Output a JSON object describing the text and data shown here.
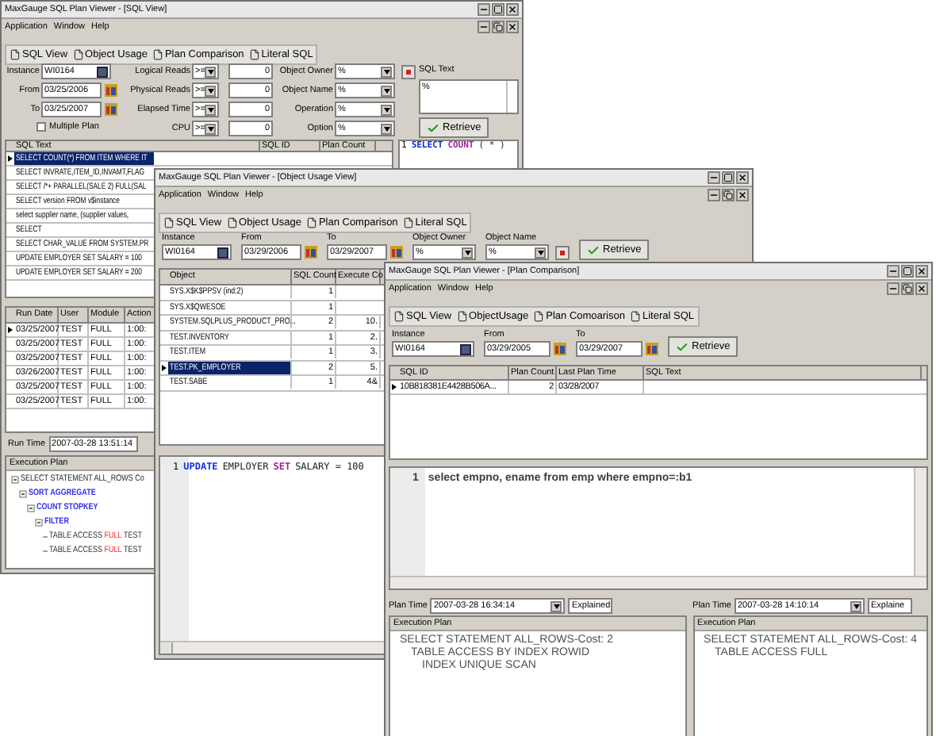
{
  "sql_view_window": {
    "title": "MaxGauge SQL Plan Viewer - [SQL View]",
    "menu": [
      "Application",
      "Window",
      "Help"
    ],
    "tabs": [
      "SQL View",
      "Object Usage",
      "Plan Comparison",
      "Literal SQL"
    ],
    "instance": {
      "label": "Instance",
      "value": "WI0164"
    },
    "from": {
      "label": "From",
      "value": "03/25/2006"
    },
    "to": {
      "label": "To",
      "value": "03/25/2007"
    },
    "multiple_plan": {
      "label": "Multiple Plan",
      "checked": false
    },
    "thresholds": [
      {
        "label": "Logical Reads",
        "operator": ">=",
        "value": "0"
      },
      {
        "label": "Physical Reads",
        "operator": ">=",
        "value": "0"
      },
      {
        "label": "Elapsed Time",
        "operator": ">=",
        "value": "0"
      },
      {
        "label": "CPU",
        "operator": ">=",
        "value": "0"
      }
    ],
    "object_filters": [
      {
        "label": "Object Owner",
        "value": "%"
      },
      {
        "label": "Object Name",
        "value": "%"
      },
      {
        "label": "Operation",
        "value": "%"
      },
      {
        "label": "Option",
        "value": "%"
      }
    ],
    "sql_text": {
      "label": "SQL Text",
      "value": "%"
    },
    "retrieve": "Retrieve",
    "sql_grid": {
      "columns": [
        "SQL Text",
        "SQL ID",
        "Plan Count"
      ],
      "rows": [
        {
          "sql_text": "SELECT COUNT(*) FROM ITEM WHERE IT",
          "selected": true
        },
        {
          "sql_text": "SELECT INVRATE,ITEM_ID,INVAMT,FLAG",
          "selected": false
        },
        {
          "sql_text": "SELECT /*+ PARALLEL(SALE 2) FULL(SAL",
          "selected": false
        },
        {
          "sql_text": "SELECT version FROM v$instance",
          "selected": false
        },
        {
          "sql_text": "select supplier name, (supplier values,",
          "selected": false
        },
        {
          "sql_text": "SELECT",
          "selected": false
        },
        {
          "sql_text": "SELECT CHAR_VALUE FROM SYSTEM.PR",
          "selected": false
        },
        {
          "sql_text": "UPDATE EMPLOYER SET SALARY = 100",
          "selected": false
        },
        {
          "sql_text": "UPDATE EMPLOYER SET SALARY = 200",
          "selected": false
        }
      ]
    },
    "editor": [
      {
        "number": "1",
        "tokens": [
          {
            "text": "SELECT",
            "kind": "keyword"
          },
          {
            "text": "COUNT",
            "kind": "function"
          },
          {
            "text": "( * )",
            "kind": "plain"
          }
        ]
      }
    ],
    "run_grid": {
      "columns": [
        "Run Date",
        "User",
        "Module",
        "Action"
      ],
      "rows": [
        {
          "cells": [
            "03/25/2007",
            "TEST",
            "FULL",
            "1:00:"
          ],
          "selected": true
        },
        {
          "cells": [
            "03/25/2007",
            "TEST",
            "FULL",
            "1:00:"
          ],
          "selected": false
        },
        {
          "cells": [
            "03/25/2007",
            "TEST",
            "FULL",
            "1:00:"
          ],
          "selected": false
        },
        {
          "cells": [
            "03/26/2007",
            "TEST",
            "FULL",
            "1:00:"
          ],
          "selected": false
        },
        {
          "cells": [
            "03/25/2007",
            "TEST",
            "FULL",
            "1:00:"
          ],
          "selected": false
        },
        {
          "cells": [
            "03/25/2007",
            "TEST",
            "FULL",
            "1:00:"
          ],
          "selected": false
        }
      ]
    },
    "run_time": {
      "label": "Run Time",
      "value": "2007-03-28 13:51:14"
    },
    "execution_plan": {
      "title": "Execution Plan",
      "nodes": [
        {
          "kind": "root",
          "segments": [
            {
              "text": "SELECT STATEMENT ALL_ROWS Co",
              "kind": "plain"
            }
          ],
          "expanded": true,
          "children": [
            {
              "kind": "operation",
              "segments": [
                {
                  "text": "SORT AGGREGATE",
                  "kind": "plain"
                }
              ],
              "expanded": true,
              "children": [
                {
                  "kind": "operation",
                  "segments": [
                    {
                      "text": "COUNT STOPKEY",
                      "kind": "plain"
                    }
                  ],
                  "expanded": true,
                  "children": [
                    {
                      "kind": "operation",
                      "segments": [
                        {
                          "text": "FILTER",
                          "kind": "plain"
                        }
                      ],
                      "expanded": true,
                      "children": [
                        {
                          "kind": "leaf",
                          "segments": [
                            {
                              "text": "TABLE ACCESS",
                              "kind": "plain"
                            },
                            {
                              "text": "FULL",
                              "kind": "option"
                            },
                            {
                              "text": "TEST",
                              "kind": "plain"
                            }
                          ]
                        },
                        {
                          "kind": "leaf",
                          "segments": [
                            {
                              "text": "TABLE ACCESS",
                              "kind": "plain"
                            },
                            {
                              "text": "FULL",
                              "kind": "option"
                            },
                            {
                              "text": "TEST",
                              "kind": "plain"
                            }
                          ]
                        }
                      ]
                    }
                  ]
                }
              ]
            }
          ]
        }
      ]
    }
  },
  "object_usage_window": {
    "title": "MaxGauge SQL Plan Viewer - [Object Usage View]",
    "menu": [
      "Application",
      "Window",
      "Help"
    ],
    "tabs": [
      "SQL View",
      "Object Usage",
      "Plan Comparison",
      "Literal SQL"
    ],
    "instance": {
      "label": "Instance",
      "value": "WI0164"
    },
    "from": {
      "label": "From",
      "value": "03/29/2006"
    },
    "to": {
      "label": "To",
      "value": "03/29/2007"
    },
    "object_owner": {
      "label": "Object Owner",
      "value": "%"
    },
    "object_name": {
      "label": "Object Name",
      "value": "%"
    },
    "retrieve": "Retrieve",
    "grid": {
      "columns": [
        "Object",
        "SQL Count",
        "Execute Co"
      ],
      "rows": [
        {
          "cells": [
            "SYS.X$K$PPSV (ind:2)",
            "1",
            ""
          ],
          "selected": false
        },
        {
          "cells": [
            "SYS.X$QWESOE",
            "1",
            ""
          ],
          "selected": false
        },
        {
          "cells": [
            "SYSTEM.SQLPLUS_PRODUCT_PRO...",
            "2",
            "10."
          ],
          "selected": false
        },
        {
          "cells": [
            "TEST.INVENTORY",
            "1",
            "2."
          ],
          "selected": false
        },
        {
          "cells": [
            "TEST.ITEM",
            "1",
            "3."
          ],
          "selected": false
        },
        {
          "cells": [
            "TEST.PK_EMPLOYER",
            "2",
            "5."
          ],
          "selected": true
        },
        {
          "cells": [
            "TEST.SABE",
            "1",
            "4&"
          ],
          "selected": false
        }
      ]
    },
    "editor": [
      {
        "number": "1",
        "tokens": [
          {
            "text": "UPDATE",
            "kind": "keyword"
          },
          {
            "text": "EMPLOYER",
            "kind": "plain"
          },
          {
            "text": "SET",
            "kind": "function"
          },
          {
            "text": "SALARY = 100",
            "kind": "plain"
          }
        ]
      }
    ]
  },
  "plan_comparison_window": {
    "title": "MaxGauge SQL Plan Viewer - [Plan Comparison]",
    "menu": [
      "Application",
      "Window",
      "Help"
    ],
    "tabs": [
      "SQL View",
      "ObjectUsage",
      "Plan Comoarison",
      "Literal SQL"
    ],
    "instance": {
      "label": "Instance",
      "value": "WI0164"
    },
    "from": {
      "label": "From",
      "value": "03/29/2005"
    },
    "to": {
      "label": "To",
      "value": "03/29/2007"
    },
    "retrieve": "Retrieve",
    "grid": {
      "columns": [
        "SQL ID",
        "Plan Count",
        "Last Plan Time",
        "SQL Text"
      ],
      "rows": [
        {
          "cells": [
            "10B818381E4428B506A...",
            "2",
            "03/28/2007",
            ""
          ],
          "selected": true
        }
      ]
    },
    "editor": [
      {
        "number": "1",
        "text": "select empno, ename from emp where empno=:b1"
      }
    ],
    "plans": [
      {
        "plan_time_label": "Plan Time",
        "plan_time": "2007-03-28 16:34:14",
        "status": "Explained",
        "title": "Execution Plan",
        "lines": [
          {
            "text": "SELECT STATEMENT ALL_ROWS-Cost: 2",
            "children": [
              {
                "text": "TABLE ACCESS BY INDEX ROWID",
                "children": [
                  {
                    "text": "INDEX UNIQUE SCAN"
                  }
                ]
              }
            ]
          }
        ]
      },
      {
        "plan_time_label": "Plan Time",
        "plan_time": "2007-03-28 14:10:14",
        "status": "Explaine",
        "title": "Execution Plan",
        "lines": [
          {
            "text": "SELECT STATEMENT ALL_ROWS-Cost: 4",
            "children": [
              {
                "text": "TABLE ACCESS FULL"
              }
            ]
          }
        ]
      }
    ]
  }
}
